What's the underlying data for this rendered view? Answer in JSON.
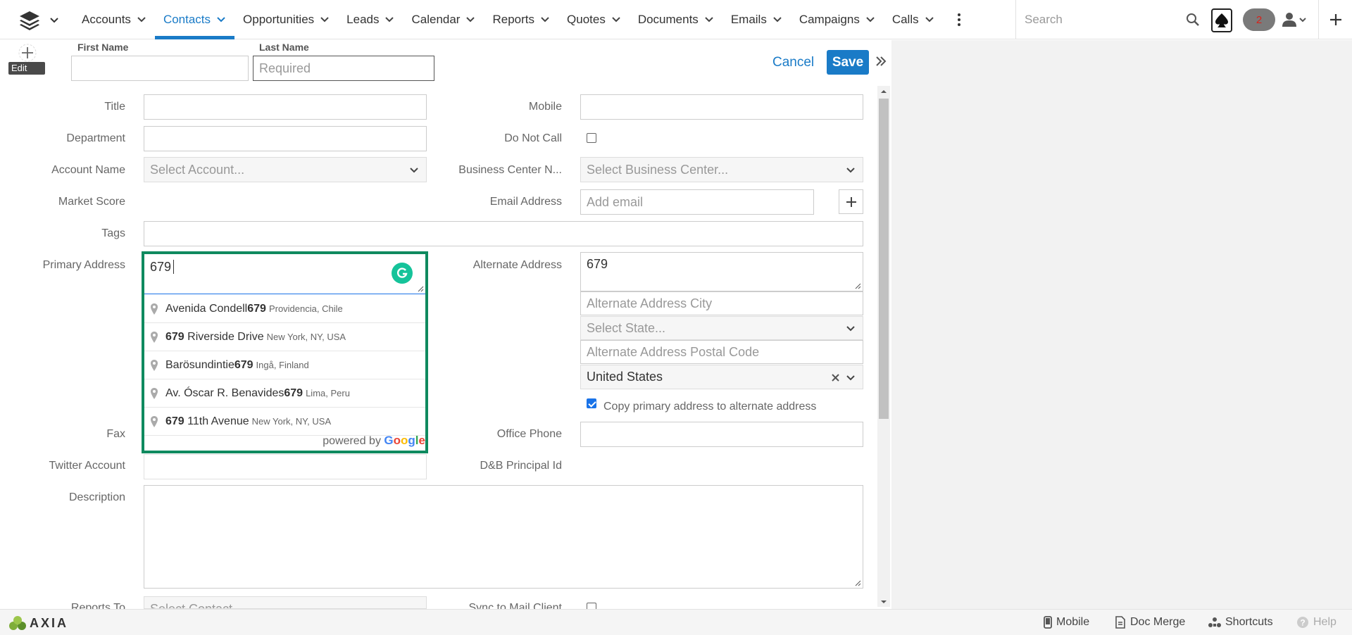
{
  "nav": {
    "items": [
      {
        "label": "Accounts"
      },
      {
        "label": "Contacts",
        "active": true
      },
      {
        "label": "Opportunities"
      },
      {
        "label": "Leads"
      },
      {
        "label": "Calendar"
      },
      {
        "label": "Reports"
      },
      {
        "label": "Quotes"
      },
      {
        "label": "Documents"
      },
      {
        "label": "Emails"
      },
      {
        "label": "Campaigns"
      },
      {
        "label": "Calls"
      }
    ],
    "search_placeholder": "Search",
    "notification_count": "2"
  },
  "header": {
    "avatar_edit_label": "Edit",
    "first_name_label": "First Name",
    "last_name_label": "Last Name",
    "first_name_value": "",
    "last_name_placeholder": "Required",
    "cancel_label": "Cancel",
    "save_label": "Save"
  },
  "form": {
    "title_label": "Title",
    "department_label": "Department",
    "account_name_label": "Account Name",
    "account_placeholder": "Select Account...",
    "market_score_label": "Market Score",
    "tags_label": "Tags",
    "primary_address_label": "Primary Address",
    "primary_address_value": "679",
    "fax_label": "Fax",
    "twitter_label": "Twitter Account",
    "description_label": "Description",
    "reports_to_label": "Reports To",
    "reports_to_placeholder": "Select Contact...",
    "mobile_label": "Mobile",
    "do_not_call_label": "Do Not Call",
    "business_center_label": "Business Center N...",
    "business_center_placeholder": "Select Business Center...",
    "email_label": "Email Address",
    "email_placeholder": "Add email",
    "alternate_address_label": "Alternate Address",
    "alternate_address_value": "679",
    "alt_city_placeholder": "Alternate Address City",
    "alt_state_placeholder": "Select State...",
    "alt_postal_placeholder": "Alternate Address Postal Code",
    "alt_country_value": "United States",
    "copy_address_label": "Copy primary address to alternate address",
    "copy_address_checked": true,
    "office_phone_label": "Office Phone",
    "dnb_label": "D&B Principal Id",
    "sync_label": "Sync to Mail Client"
  },
  "autocomplete": {
    "suggestions": [
      {
        "pre": "Avenida Condell ",
        "match": "679",
        "post": "",
        "secondary": "Providencia, Chile"
      },
      {
        "pre": "",
        "match": "679",
        "post": " Riverside Drive",
        "secondary": "New York, NY, USA"
      },
      {
        "pre": "Barösundintie ",
        "match": "679",
        "post": "",
        "secondary": "Ingå, Finland"
      },
      {
        "pre": "Av. Óscar R. Benavides ",
        "match": "679",
        "post": "",
        "secondary": "Lima, Peru"
      },
      {
        "pre": "",
        "match": "679",
        "post": " 11th Avenue",
        "secondary": "New York, NY, USA"
      }
    ],
    "powered_by": "powered by",
    "google_letters": [
      "G",
      "o",
      "o",
      "g",
      "l",
      "e"
    ]
  },
  "footer": {
    "brand": "AXIA",
    "mobile_label": "Mobile",
    "doc_merge_label": "Doc Merge",
    "shortcuts_label": "Shortcuts",
    "help_label": "Help"
  },
  "colors": {
    "accent": "#1a7bc7",
    "autocomplete_border": "#0f8a5f",
    "grammarly": "#15c39a"
  }
}
